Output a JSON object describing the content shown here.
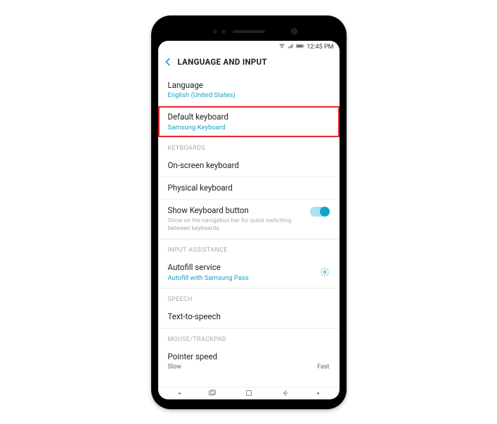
{
  "status_bar": {
    "time": "12:45 PM"
  },
  "header": {
    "title": "LANGUAGE AND INPUT"
  },
  "items": {
    "language": {
      "title": "Language",
      "sub": "English (United States)"
    },
    "default_keyboard": {
      "title": "Default keyboard",
      "sub": "Samsung Keyboard"
    },
    "section_keyboards": "KEYBOARDS",
    "onscreen": {
      "title": "On-screen keyboard"
    },
    "physical": {
      "title": "Physical keyboard"
    },
    "show_keyboard_button": {
      "title": "Show Keyboard button",
      "desc": "Show on the navigation bar for quick switching between keyboards."
    },
    "section_input_assistance": "INPUT ASSISTANCE",
    "autofill": {
      "title": "Autofill service",
      "sub": "Autofill with Samsung Pass"
    },
    "section_speech": "SPEECH",
    "tts": {
      "title": "Text-to-speech"
    },
    "section_mouse": "MOUSE/TRACKPAD",
    "pointer_speed": {
      "title": "Pointer speed",
      "slow": "Slow",
      "fast": "Fast"
    }
  }
}
